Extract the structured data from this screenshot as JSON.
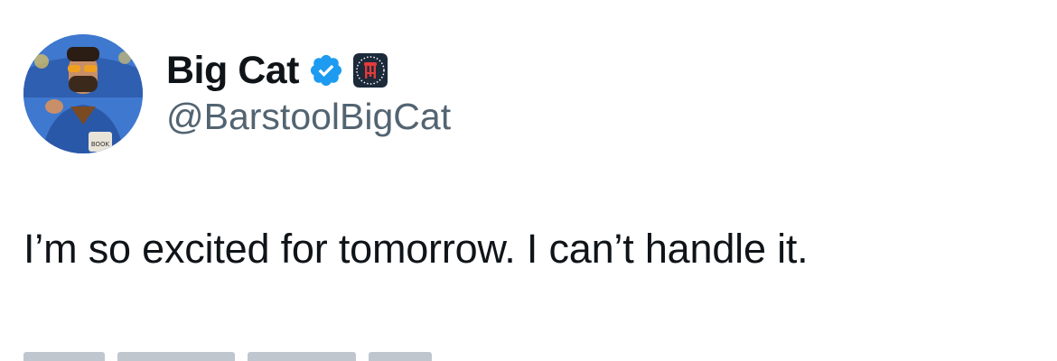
{
  "author": {
    "display_name": "Big Cat",
    "handle": "@BarstoolBigCat",
    "verified_icon": "verified-badge-icon",
    "affiliate_icon": "barstool-stool-icon",
    "avatar_caption": "BOOK"
  },
  "tweet": {
    "text": "I’m so excited for tomorrow. I can’t handle it."
  },
  "colors": {
    "name": "#0f1419",
    "handle": "#536471",
    "verified": "#1d9bf0",
    "affiliate_bg": "#1c2a3a"
  }
}
